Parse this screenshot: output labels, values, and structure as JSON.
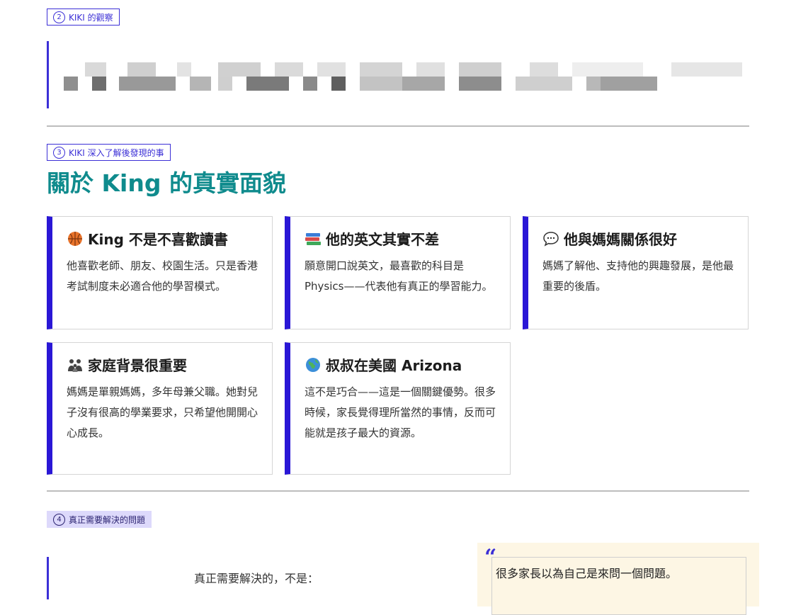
{
  "sections": [
    {
      "num": "2",
      "label": "KIKI 的觀察"
    },
    {
      "num": "3",
      "label": "KIKI 深入了解後發現的事"
    },
    {
      "num": "4",
      "label": "真正需要解決的問題"
    }
  ],
  "main_title": "關於 King 的真實面貌",
  "cards": [
    {
      "icon": "basketball-icon",
      "title": "King 不是不喜歡讀書",
      "body": "他喜歡老師、朋友、校園生活。只是香港考試制度未必適合他的學習模式。"
    },
    {
      "icon": "books-icon",
      "title": "他的英文其實不差",
      "body": "願意開口說英文，最喜歡的科目是 Physics——代表他有真正的學習能力。"
    },
    {
      "icon": "speech-bubble-icon",
      "title": "他與媽媽關係很好",
      "body": "媽媽了解他、支持他的興趣發展，是他最重要的後盾。"
    },
    {
      "icon": "family-icon",
      "title": "家庭背景很重要",
      "body": "媽媽是單親媽媽，多年母兼父職。她對兒子沒有很高的學業要求，只希望他開開心心成長。"
    },
    {
      "icon": "globe-icon",
      "title": "叔叔在美國 Arizona",
      "body": "這不是巧合——這是一個關鍵優勢。很多時候，家長覺得理所當然的事情，反而可能就是孩子最大的資源。"
    }
  ],
  "problem": {
    "lead": "真正需要解決的，不是：",
    "quote": "很多家長以為自己是來問一個問題。"
  },
  "colors": {
    "accent": "#3b2fd6",
    "title": "#0f8b8d",
    "card_bar": "#2a17d6"
  }
}
